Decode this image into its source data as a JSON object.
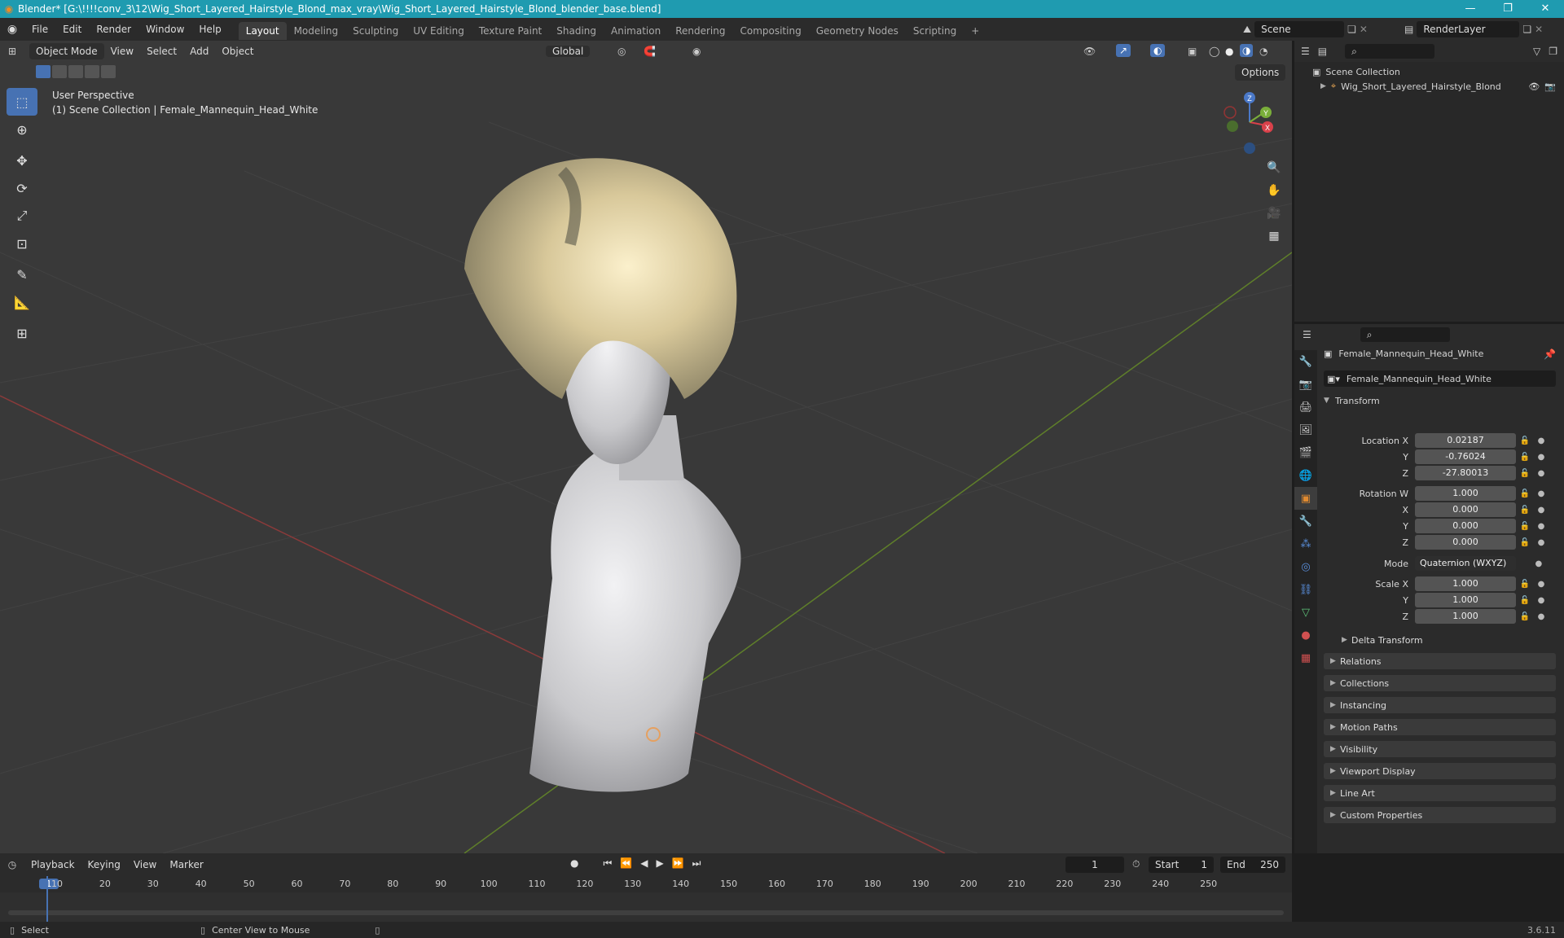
{
  "window": {
    "title": "Blender* [G:\\!!!!conv_3\\12\\Wig_Short_Layered_Hairstyle_Blond_max_vray\\Wig_Short_Layered_Hairstyle_Blond_blender_base.blend]",
    "minimize": "—",
    "maximize": "❐",
    "close": "✕"
  },
  "menu": {
    "file": "File",
    "edit": "Edit",
    "render": "Render",
    "window": "Window",
    "help": "Help"
  },
  "workspaces": [
    "Layout",
    "Modeling",
    "Sculpting",
    "UV Editing",
    "Texture Paint",
    "Shading",
    "Animation",
    "Rendering",
    "Compositing",
    "Geometry Nodes",
    "Scripting"
  ],
  "add_workspace": "+",
  "scene": {
    "name": "Scene",
    "render_layer": "RenderLayer"
  },
  "viewport": {
    "mode": "Object Mode",
    "menus": {
      "view": "View",
      "select": "Select",
      "add": "Add",
      "object": "Object"
    },
    "orientation": "Global",
    "options": "Options",
    "perspective": "User Perspective",
    "collection_info": "(1) Scene Collection | Female_Mannequin_Head_White",
    "gizmo": {
      "z": "Z",
      "y": "Y",
      "x": "X"
    }
  },
  "outliner": {
    "root": "Scene Collection",
    "items": [
      {
        "label": "Wig_Short_Layered_Hairstyle_Blond"
      }
    ]
  },
  "properties": {
    "object_name": "Female_Mannequin_Head_White",
    "data_name": "Female_Mannequin_Head_White",
    "transform_title": "Transform",
    "location": {
      "label": "Location X",
      "x": "0.02187",
      "y": "-0.76024",
      "z": "-27.80013"
    },
    "rotation": {
      "label": "Rotation W",
      "w": "1.000",
      "x": "0.000",
      "y": "0.000",
      "z": "0.000"
    },
    "mode_label": "Mode",
    "mode_value": "Quaternion (WXYZ)",
    "scale": {
      "label": "Scale X",
      "x": "1.000",
      "y": "1.000",
      "z": "1.000"
    },
    "axis": {
      "y": "Y",
      "z": "Z",
      "x": "X"
    },
    "delta_transform": "Delta Transform",
    "panels": [
      "Relations",
      "Collections",
      "Instancing",
      "Motion Paths",
      "Visibility",
      "Viewport Display",
      "Line Art",
      "Custom Properties"
    ]
  },
  "timeline": {
    "menus": {
      "playback": "Playback",
      "keying": "Keying",
      "view": "View",
      "marker": "Marker"
    },
    "current_frame": "1",
    "start_label": "Start",
    "start": "1",
    "end_label": "End",
    "end": "250",
    "ruler": [
      "1",
      "10",
      "20",
      "30",
      "40",
      "50",
      "60",
      "70",
      "80",
      "90",
      "100",
      "110",
      "120",
      "130",
      "140",
      "150",
      "160",
      "170",
      "180",
      "190",
      "200",
      "210",
      "220",
      "230",
      "240",
      "250"
    ]
  },
  "status": {
    "select": "Select",
    "center_view": "Center View to Mouse",
    "version": "3.6.11"
  }
}
